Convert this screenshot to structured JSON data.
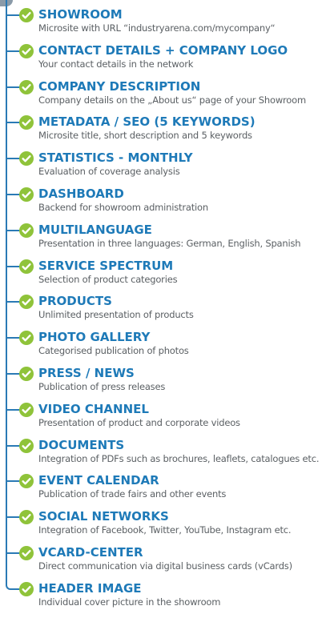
{
  "features": [
    {
      "title": "SHOWROOM",
      "description": "Microsite with URL “industryarena.com/mycompany“"
    },
    {
      "title": "CONTACT DETAILS + COMPANY LOGO",
      "description": "Your contact details in the network"
    },
    {
      "title": "COMPANY DESCRIPTION",
      "description": "Company details on the „About us“ page of your Showroom"
    },
    {
      "title": "METADATA / SEO (5 KEYWORDS)",
      "description": "Microsite title, short description and 5 keywords"
    },
    {
      "title": "STATISTICS - MONTHLY",
      "description": "Evaluation of coverage analysis"
    },
    {
      "title": "DASHBOARD",
      "description": "Backend for showroom administration"
    },
    {
      "title": "MULTILANGUAGE",
      "description": "Presentation in three languages: German, English, Spanish"
    },
    {
      "title": "SERVICE SPECTRUM",
      "description": "Selection of product categories"
    },
    {
      "title": "PRODUCTS",
      "description": "Unlimited presentation of products"
    },
    {
      "title": "PHOTO GALLERY",
      "description": "Categorised publication of photos"
    },
    {
      "title": "PRESS / NEWS",
      "description": "Publication of press releases"
    },
    {
      "title": "VIDEO CHANNEL",
      "description": "Presentation of product and corporate videos"
    },
    {
      "title": "DOCUMENTS",
      "description": "Integration of PDFs such as brochures, leaflets, catalogues etc."
    },
    {
      "title": "EVENT CALENDAR",
      "description": "Publication of trade fairs and other events"
    },
    {
      "title": "SOCIAL NETWORKS",
      "description": "Integration of Facebook, Twitter, YouTube, Instagram etc."
    },
    {
      "title": "VCARD-CENTER",
      "description": "Direct communication via digital business cards (vCards)"
    },
    {
      "title": "HEADER IMAGE",
      "description": "Individual cover picture in the showroom"
    }
  ],
  "icons": {
    "check": "check-circle-icon"
  },
  "colors": {
    "title": "#1e7ab8",
    "line": "#2a7ab5",
    "check": "#8fc33a",
    "description": "#5a5f63"
  }
}
